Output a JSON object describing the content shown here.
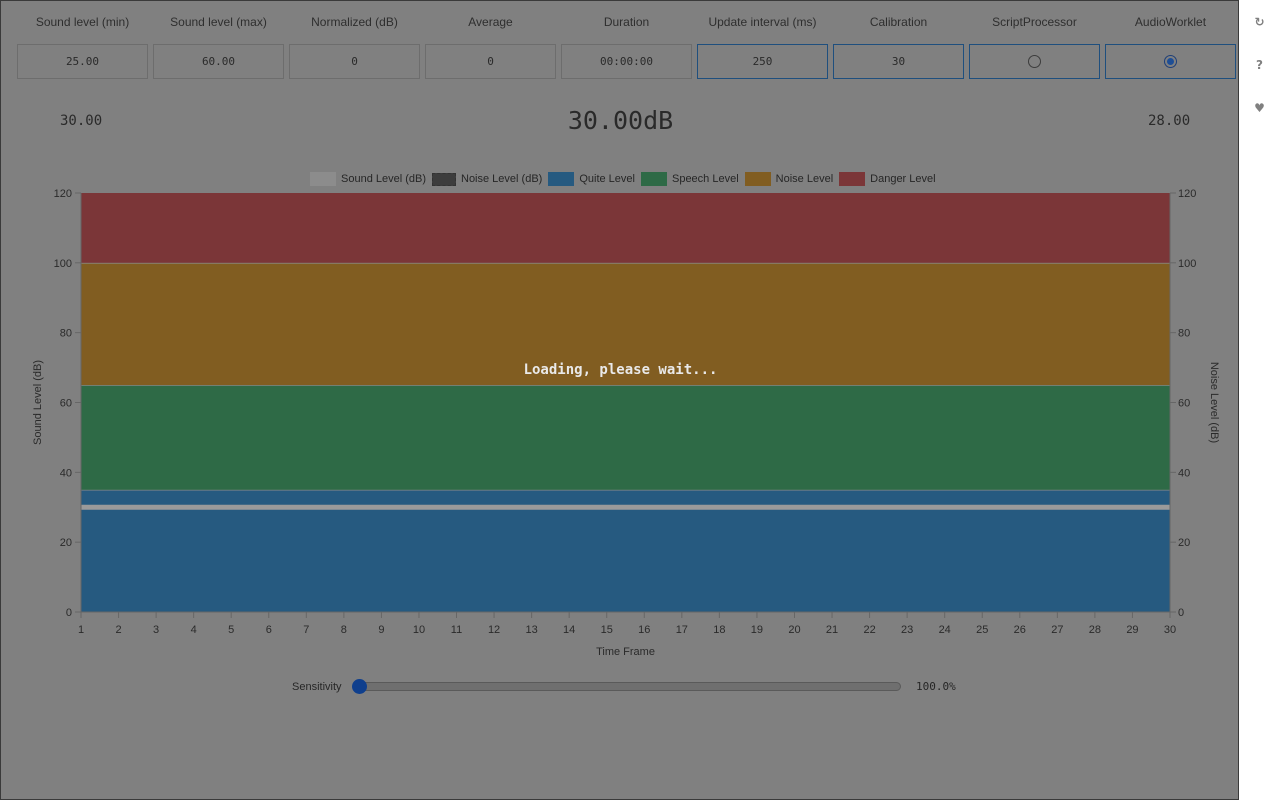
{
  "stats": [
    {
      "label": "Sound level (min)",
      "value": "25.00",
      "type": "text"
    },
    {
      "label": "Sound level (max)",
      "value": "60.00",
      "type": "text"
    },
    {
      "label": "Normalized (dB)",
      "value": "0",
      "type": "text"
    },
    {
      "label": "Average",
      "value": "0",
      "type": "text"
    },
    {
      "label": "Duration",
      "value": "00:00:00",
      "type": "text"
    },
    {
      "label": "Update interval (ms)",
      "value": "250",
      "type": "input"
    },
    {
      "label": "Calibration",
      "value": "30",
      "type": "input"
    },
    {
      "label": "ScriptProcessor",
      "checked": false,
      "type": "radio"
    },
    {
      "label": "AudioWorklet",
      "checked": true,
      "type": "radio"
    }
  ],
  "readouts": {
    "left": "30.00",
    "center": "30.00dB",
    "right": "28.00"
  },
  "loading_text": "Loading, please wait...",
  "sidebar": [
    {
      "icon": "refresh-icon",
      "glyph": "↻"
    },
    {
      "icon": "help-icon",
      "glyph": "?"
    },
    {
      "icon": "heart-icon",
      "glyph": "♥"
    }
  ],
  "sensitivity": {
    "label": "Sensitivity",
    "value_text": "100.0%",
    "fraction": 0.0
  },
  "colors": {
    "quiet": "#265a80",
    "speech": "#2e6a46",
    "noise": "#815d21",
    "danger": "#7b3638",
    "sound_line": "#9a9a9a",
    "noise_line": "#3d3d3d"
  },
  "chart_data": {
    "type": "area",
    "xlabel": "Time Frame",
    "ylabel_left": "Sound Level (dB)",
    "ylabel_right": "Noise Level (dB)",
    "x": [
      1,
      2,
      3,
      4,
      5,
      6,
      7,
      8,
      9,
      10,
      11,
      12,
      13,
      14,
      15,
      16,
      17,
      18,
      19,
      20,
      21,
      22,
      23,
      24,
      25,
      26,
      27,
      28,
      29,
      30
    ],
    "ylim": [
      0,
      120
    ],
    "yticks": [
      0,
      20,
      40,
      60,
      80,
      100,
      120
    ],
    "legend": [
      "Sound Level (dB)",
      "Noise Level (dB)",
      "Quite Level",
      "Speech Level",
      "Noise Level",
      "Danger Level"
    ],
    "legend_position": "top",
    "bands": [
      {
        "name": "Quite Level",
        "from": 0,
        "to": 35
      },
      {
        "name": "Speech Level",
        "from": 35,
        "to": 65
      },
      {
        "name": "Noise Level",
        "from": 65,
        "to": 100
      },
      {
        "name": "Danger Level",
        "from": 100,
        "to": 120
      }
    ],
    "series": [
      {
        "name": "Sound Level (dB)",
        "values": [
          30,
          30,
          30,
          30,
          30,
          30,
          30,
          30,
          30,
          30,
          30,
          30,
          30,
          30,
          30,
          30,
          30,
          30,
          30,
          30,
          30,
          30,
          30,
          30,
          30,
          30,
          30,
          30,
          30,
          30
        ]
      }
    ]
  }
}
